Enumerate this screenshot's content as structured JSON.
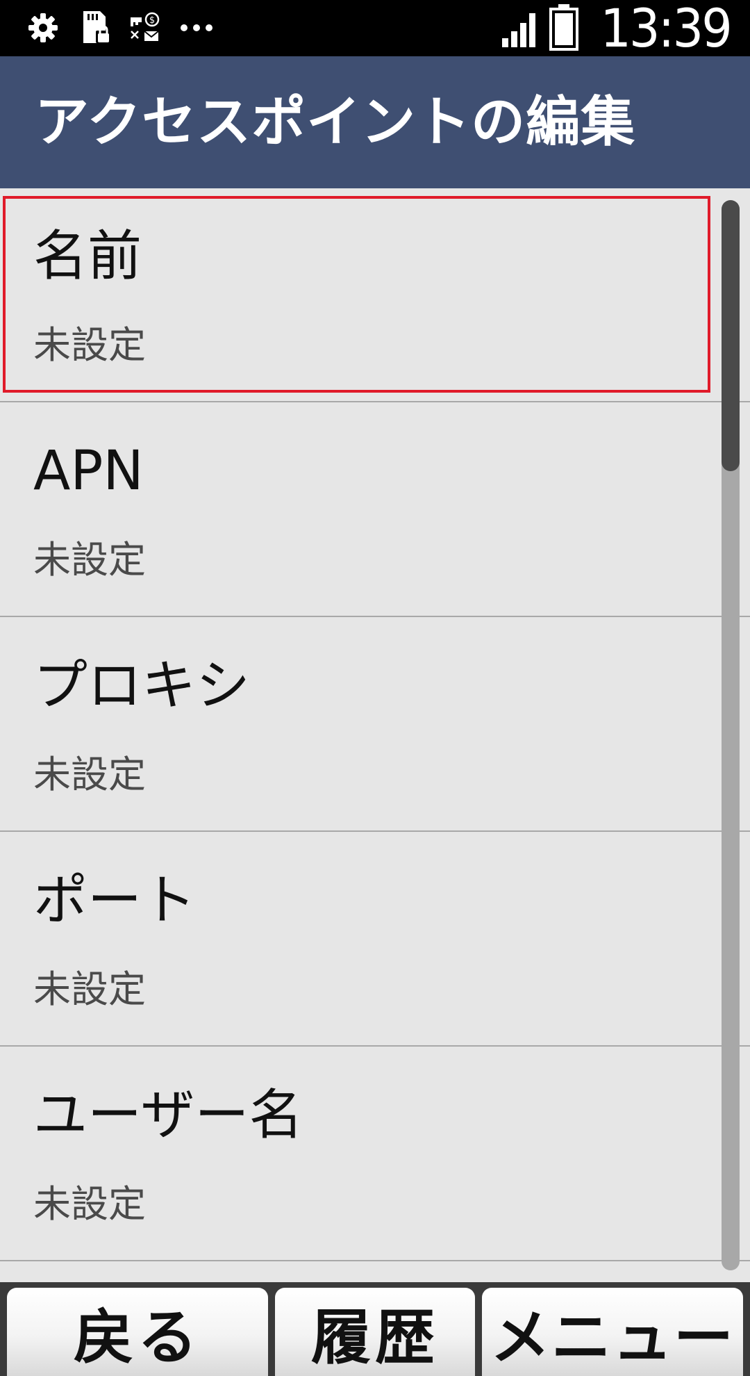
{
  "status_bar": {
    "icons_left": [
      "gear-icon",
      "sd-card-lock-icon",
      "key-message-icon",
      "more-dots-icon"
    ],
    "icons_right": [
      "signal-icon",
      "battery-icon"
    ],
    "time": "13:39"
  },
  "header": {
    "title": "アクセスポイントの編集"
  },
  "list": {
    "items": [
      {
        "title": "名前",
        "value": "未設定",
        "focused": true
      },
      {
        "title": "APN",
        "value": "未設定"
      },
      {
        "title": "プロキシ",
        "value": "未設定"
      },
      {
        "title": "ポート",
        "value": "未設定"
      },
      {
        "title": "ユーザー名",
        "value": "未設定"
      }
    ]
  },
  "softkeys": {
    "back": "戻る",
    "history": "履歴",
    "menu": "メニュー"
  },
  "colors": {
    "title_bar": "#3f4f72",
    "focus": "#e01b2a",
    "background": "#e6e6e6"
  }
}
